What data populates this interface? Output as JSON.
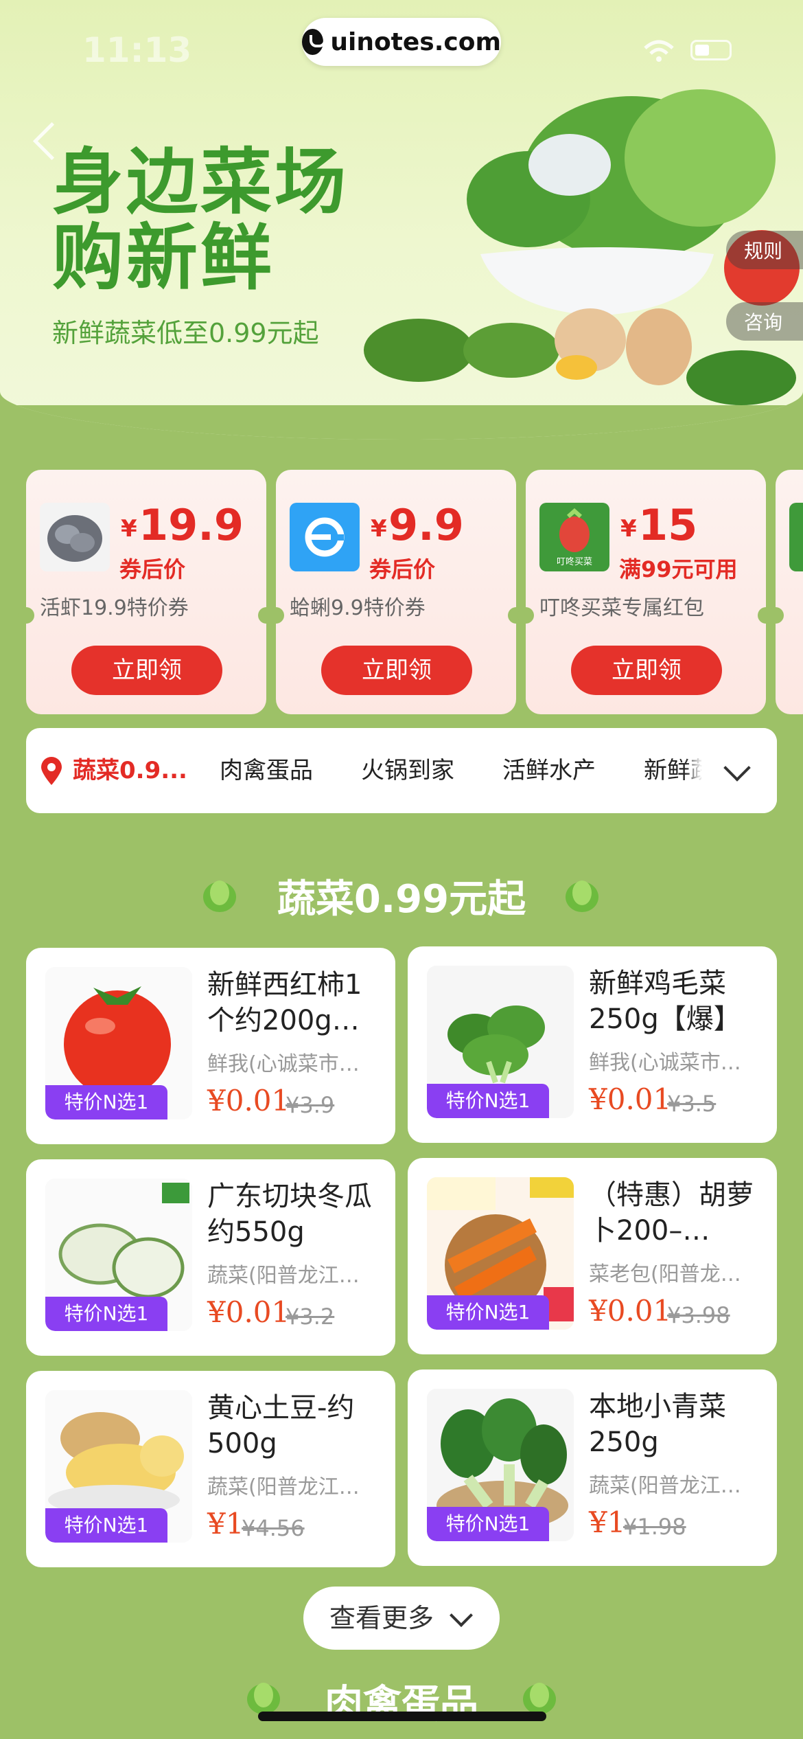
{
  "status": {
    "time": "11:13",
    "watermark": "uinotes.com"
  },
  "hero": {
    "title_line1": "身边菜场",
    "title_line2": "购新鲜",
    "subtitle": "新鲜蔬菜低至0.99元起",
    "side_tabs": [
      "规则",
      "咨询"
    ]
  },
  "coupons": [
    {
      "currency": "¥",
      "amount": "19.9",
      "condition": "券后价",
      "desc": "活虾19.9特价券",
      "button": "立即领",
      "logo": "shrimp-logo"
    },
    {
      "currency": "¥",
      "amount": "9.9",
      "condition": "券后价",
      "desc": "蛤蜊9.9特价券",
      "button": "立即领",
      "logo": "eleme-logo"
    },
    {
      "currency": "¥",
      "amount": "15",
      "condition": "满99元可用",
      "desc": "叮咚买菜专属红包",
      "button": "立即领",
      "logo": "dingdong-logo",
      "logo_text": "叮咚买菜"
    }
  ],
  "tabs": [
    {
      "label": "蔬菜0.9...",
      "active": true
    },
    {
      "label": "肉禽蛋品"
    },
    {
      "label": "火锅到家"
    },
    {
      "label": "活鲜水产"
    },
    {
      "label": "新鲜蔬"
    }
  ],
  "section": {
    "title": "蔬菜0.99元起",
    "next_title": "肉禽蛋品"
  },
  "products": [
    {
      "name": "新鲜西红柿1个约200g…",
      "shop": "鲜我(心诚菜市…",
      "price": "¥0.01",
      "old_price": "¥3.9",
      "badge": "特价N选1",
      "image": "tomato"
    },
    {
      "name": "新鲜鸡毛菜250g【爆】",
      "shop": "鲜我(心诚菜市…",
      "price": "¥0.01",
      "old_price": "¥3.5",
      "badge": "特价N选1",
      "image": "greens"
    },
    {
      "name": "广东切块冬瓜约550g",
      "shop": "蔬菜(阳普龙江…",
      "price": "¥0.01",
      "old_price": "¥3.2",
      "badge": "特价N选1",
      "image": "wax-gourd"
    },
    {
      "name": "（特惠）胡萝卜200–…",
      "shop": "菜老包(阳普龙…",
      "price": "¥0.01",
      "old_price": "¥3.98",
      "badge": "特价N选1",
      "image": "carrot"
    },
    {
      "name": "黄心土豆-约500g",
      "shop": "蔬菜(阳普龙江…",
      "price": "¥1",
      "old_price": "¥4.56",
      "badge": "特价N选1",
      "image": "potato"
    },
    {
      "name": "本地小青菜250g",
      "shop": "蔬菜(阳普龙江…",
      "price": "¥1",
      "old_price": "¥1.98",
      "badge": "特价N选1",
      "image": "bok-choy"
    }
  ],
  "more_button": "查看更多",
  "colors": {
    "page_bg": "#9dc167",
    "accent_red": "#e32b25",
    "badge_purple": "#8a3ff2",
    "price_orange": "#e84a22",
    "hero_green": "#3d9a2d"
  }
}
